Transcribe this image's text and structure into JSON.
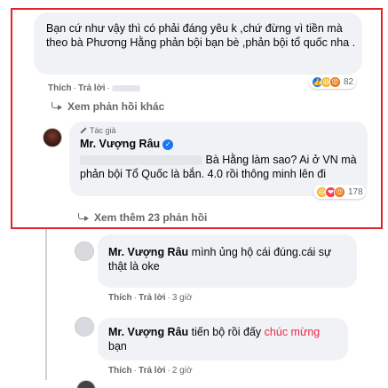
{
  "comment1": {
    "text": "Bạn cứ như vậy thì có phải đáng yêu k ,chứ đừng vì tiền mà theo bà Phương Hằng phản bội bạn bè ,phản bội tổ quốc nha .",
    "like": "Thích",
    "reply": "Trả lời",
    "reaction_count": "82",
    "reaction_icons": [
      "like",
      "haha",
      "angry"
    ]
  },
  "comment1_more": "Xem phản hồi khác",
  "reply1": {
    "badge": "Tác giả",
    "author": "Mr. Vượng Râu",
    "text_suffix": "Bà Hằng làm sao? Ai ở VN mà phản bội Tổ Quốc là bắn. 4.0 rồi thông minh lên đi",
    "reaction_count": "178",
    "reaction_icons": [
      "haha",
      "love",
      "angry"
    ]
  },
  "reply1_more": "Xem thêm 23 phản hồi",
  "reply2": {
    "author": "Mr. Vượng Râu",
    "text": "mình ủng hộ cái đúng.cái sự thật là oke",
    "like": "Thích",
    "reply": "Trả lời",
    "time": "3 giờ"
  },
  "reply3": {
    "author": "Mr. Vượng Râu",
    "text_a": "tiến bộ rồi đấy",
    "text_red": "chúc mừng",
    "text_b": "bạn",
    "like": "Thích",
    "reply": "Trả lời",
    "time": "2 giờ"
  },
  "colors": {
    "highlight": "#e0262a",
    "bubble": "#f0f2f5",
    "accent": "#1877f2",
    "red_text": "#f02849"
  }
}
